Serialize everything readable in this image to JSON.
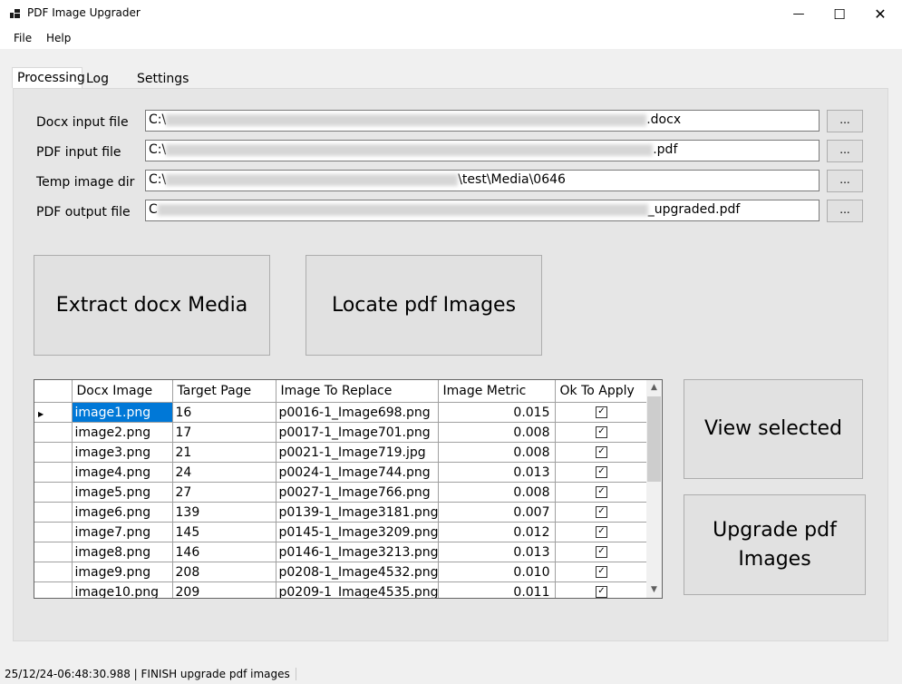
{
  "window": {
    "title": "PDF Image Upgrader",
    "minimize_glyph": "—",
    "maximize_glyph": "☐",
    "close_glyph": "✕"
  },
  "menu": {
    "file": "File",
    "help": "Help"
  },
  "tabs": {
    "processing": "Processing",
    "log": "Log",
    "settings": "Settings"
  },
  "fields": {
    "docx": {
      "label": "Docx input file",
      "prefix": "C:\\",
      "suffix": ".docx"
    },
    "pdf_in": {
      "label": "PDF input file",
      "prefix": "C:\\",
      "suffix": ".pdf"
    },
    "temp": {
      "label": "Temp image dir",
      "prefix": "C:\\",
      "suffix": "\\test\\Media\\0646"
    },
    "pdf_out": {
      "label": "PDF output file",
      "prefix": "C",
      "suffix": "_upgraded.pdf"
    },
    "browse_label": "..."
  },
  "buttons": {
    "extract": "Extract docx Media",
    "locate": "Locate pdf Images",
    "view": "View selected",
    "upgrade": "Upgrade pdf Images"
  },
  "grid": {
    "headers": [
      "Docx Image",
      "Target Page",
      "Image To Replace",
      "Image Metric",
      "Ok To Apply"
    ],
    "rows": [
      {
        "docx": "image1.png",
        "page": "16",
        "replace": "p0016-1_Image698.png",
        "metric": "0.015",
        "ok": true
      },
      {
        "docx": "image2.png",
        "page": "17",
        "replace": "p0017-1_Image701.png",
        "metric": "0.008",
        "ok": true
      },
      {
        "docx": "image3.png",
        "page": "21",
        "replace": "p0021-1_Image719.jpg",
        "metric": "0.008",
        "ok": true
      },
      {
        "docx": "image4.png",
        "page": "24",
        "replace": "p0024-1_Image744.png",
        "metric": "0.013",
        "ok": true
      },
      {
        "docx": "image5.png",
        "page": "27",
        "replace": "p0027-1_Image766.png",
        "metric": "0.008",
        "ok": true
      },
      {
        "docx": "image6.png",
        "page": "139",
        "replace": "p0139-1_Image3181.png",
        "metric": "0.007",
        "ok": true
      },
      {
        "docx": "image7.png",
        "page": "145",
        "replace": "p0145-1_Image3209.png",
        "metric": "0.012",
        "ok": true
      },
      {
        "docx": "image8.png",
        "page": "146",
        "replace": "p0146-1_Image3213.png",
        "metric": "0.013",
        "ok": true
      },
      {
        "docx": "image9.png",
        "page": "208",
        "replace": "p0208-1_Image4532.png",
        "metric": "0.010",
        "ok": true
      },
      {
        "docx": "image10.png",
        "page": "209",
        "replace": "p0209-1_Image4535.png",
        "metric": "0.011",
        "ok": true
      }
    ]
  },
  "status": {
    "text": "25/12/24-06:48:30.988 | FINISH upgrade pdf images"
  },
  "colors": {
    "selection": "#0078d7",
    "tab_page": "#e6e6e6",
    "button": "#e1e1e1"
  }
}
